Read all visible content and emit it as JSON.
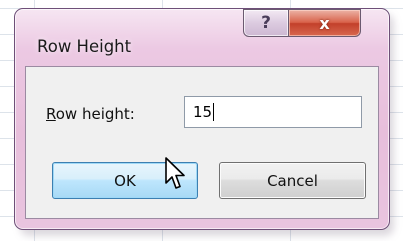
{
  "dialog": {
    "title": "Row Height",
    "help_glyph": "?",
    "close_glyph": "x"
  },
  "field": {
    "label_mnemonic": "R",
    "label_rest": "ow height:",
    "value": "15"
  },
  "buttons": {
    "ok": "OK",
    "cancel": "Cancel"
  },
  "icons": {
    "pointer": "mouse-pointer-icon"
  }
}
